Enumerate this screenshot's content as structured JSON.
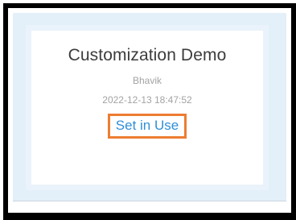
{
  "card": {
    "title": "Customization Demo",
    "author": "Bhavik",
    "timestamp": "2022-12-13 18:47:52",
    "action_label": "Set in Use"
  },
  "colors": {
    "action_text": "#2f8fd8",
    "highlight_border": "#ed7d31",
    "backdrop": "#e3eff9"
  }
}
